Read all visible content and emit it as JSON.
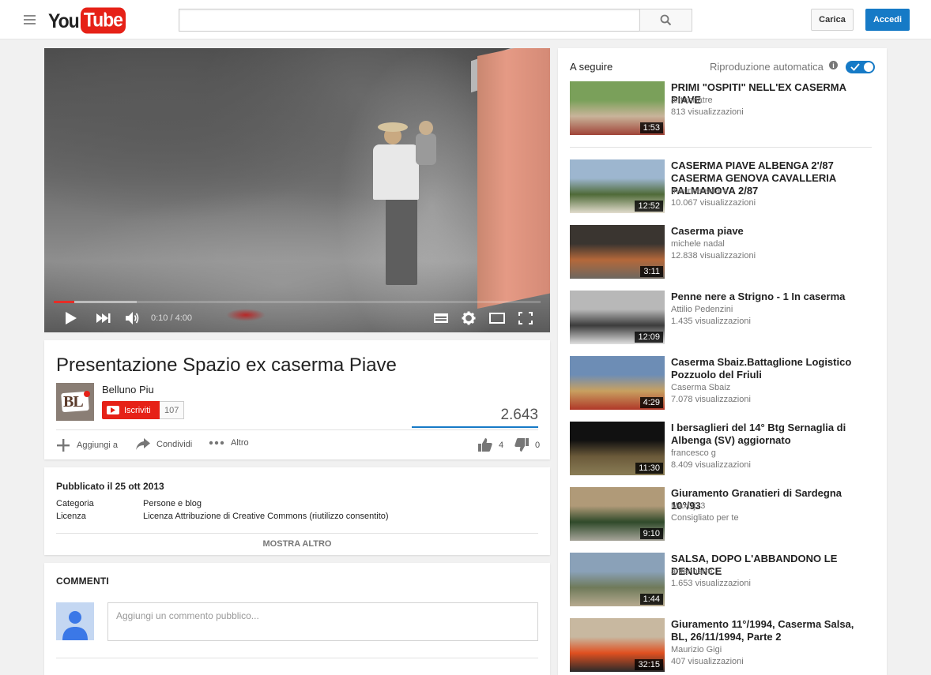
{
  "masthead": {
    "logo_you": "You",
    "logo_tube": "Tube",
    "logo_country": "IT",
    "search_placeholder": "",
    "upload_label": "Carica",
    "signin_label": "Accedi"
  },
  "player": {
    "time_current": "0:10",
    "time_total": "4:00",
    "progress_played_fraction": 0.042,
    "progress_loaded_fraction": 0.17
  },
  "video": {
    "title": "Presentazione Spazio ex caserma Piave",
    "channel_name": "Belluno Piu",
    "channel_logo_text": "BL",
    "subscribe_label": "Iscriviti",
    "subscriber_count": "107",
    "view_count": "2.643",
    "add_to_label": "Aggiungi a",
    "share_label": "Condividi",
    "more_label": "Altro",
    "likes": "4",
    "dislikes": "0"
  },
  "description": {
    "published": "Pubblicato il 25 ott 2013",
    "category_key": "Categoria",
    "category_val": "Persone e blog",
    "license_key": "Licenza",
    "license_val": "Licenza Attribuzione di Creative Commons (riutilizzo consentito)",
    "show_more": "MOSTRA ALTRO"
  },
  "comments": {
    "header": "COMMENTI",
    "placeholder": "Aggiungi un commento pubblico..."
  },
  "sidebar": {
    "up_next": "A seguire",
    "autoplay_label": "Riproduzione automatica",
    "autoplay_on": true,
    "items": [
      {
        "title": "PRIMI \"OSPITI\" NELL'EX CASERMA PIAVE",
        "channel": "antennatre",
        "views": "813 visualizzazioni",
        "duration": "1:53",
        "thumb_colors": [
          "#7aa05a",
          "#c9b49a",
          "#a04438"
        ]
      },
      {
        "title": "CASERMA PIAVE ALBENGA 2'/87 CASERMA GENOVA CAVALLERIA PALMANOVA 2/87",
        "channel": "maurice solare",
        "views": "10.067 visualizzazioni",
        "duration": "12:52",
        "thumb_colors": [
          "#9db6cf",
          "#4f6a38",
          "#e2dccd"
        ]
      },
      {
        "title": "Caserma piave",
        "channel": "michele nadal",
        "views": "12.838 visualizzazioni",
        "duration": "3:11",
        "thumb_colors": [
          "#3a3530",
          "#b4683a",
          "#6c6760"
        ]
      },
      {
        "title": "Penne nere a Strigno - 1 In caserma",
        "channel": "Attilio Pedenzini",
        "views": "1.435 visualizzazioni",
        "duration": "12:09",
        "thumb_colors": [
          "#b8b8b8",
          "#3c3c3c",
          "#e0e0e0"
        ]
      },
      {
        "title": "Caserma Sbaiz.Battaglione Logistico Pozzuolo del Friuli",
        "channel": "Caserma Sbaiz",
        "views": "7.078 visualizzazioni",
        "duration": "4:29",
        "thumb_colors": [
          "#6d8db5",
          "#c8a060",
          "#b03828"
        ]
      },
      {
        "title": "I bersaglieri del 14° Btg Sernaglia di Albenga (SV) aggiornato",
        "channel": "francesco g",
        "views": "8.409 visualizzazioni",
        "duration": "11:30",
        "thumb_colors": [
          "#111111",
          "#6b5a3a",
          "#8a7d56"
        ]
      },
      {
        "title": "Giuramento Granatieri di Sardegna 10°/93",
        "channel": "MaxDj73",
        "views": "Consigliato per te",
        "duration": "9:10",
        "thumb_colors": [
          "#b09a78",
          "#2f4a2a",
          "#a7a59a"
        ]
      },
      {
        "title": "SALSA, DOPO L'ABBANDONO LE DENUNCE",
        "channel": "antennatre",
        "views": "1.653 visualizzazioni",
        "duration": "1:44",
        "thumb_colors": [
          "#8aa1b8",
          "#6f7a5a",
          "#b7aa90"
        ]
      },
      {
        "title": "Giuramento 11°/1994, Caserma Salsa, BL, 26/11/1994, Parte 2",
        "channel": "Maurizio Gigi",
        "views": "407 visualizzazioni",
        "duration": "32:15",
        "thumb_colors": [
          "#c8b8a0",
          "#e05020",
          "#2a2a2a"
        ]
      }
    ]
  }
}
